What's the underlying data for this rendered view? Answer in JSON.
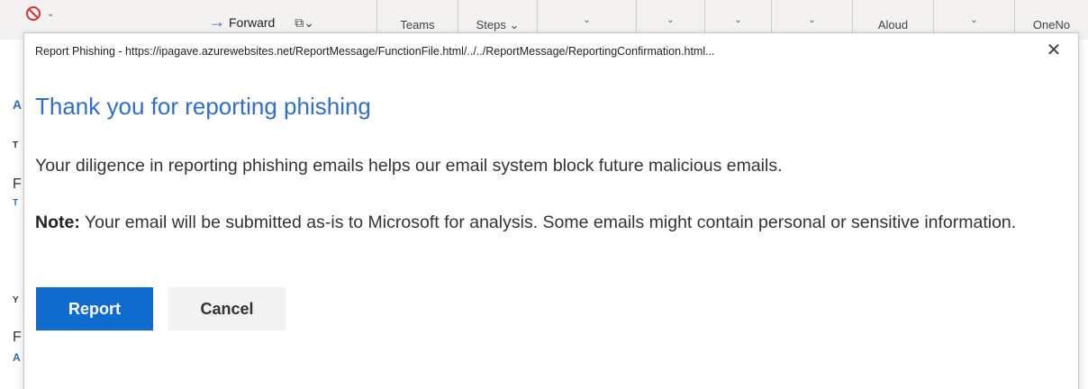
{
  "ribbon": {
    "forward_label": "Forward",
    "share_label": "Teams",
    "quick_steps_label": "Steps",
    "read_aloud_label": "Aloud",
    "onenote_label": "OneNo"
  },
  "leftpane": {
    "letters": [
      "A",
      "T",
      "F",
      "T",
      "Y",
      "F",
      "A"
    ]
  },
  "dialog": {
    "title": "Report Phishing - https://ipagave.azurewebsites.net/ReportMessage/FunctionFile.html/../../ReportMessage/ReportingConfirmation.html...",
    "close_glyph": "✕",
    "heading": "Thank you for reporting phishing",
    "paragraph": "Your diligence in reporting phishing emails helps our email system block future malicious emails.",
    "note_label": "Note:",
    "note_text": " Your email will be submitted as-is to Microsoft for analysis. Some emails might contain personal or sensitive information.",
    "report_button": "Report",
    "cancel_button": "Cancel"
  },
  "colors": {
    "heading": "#2f6ec9",
    "primary_button": "#0f6cce",
    "secondary_button": "#f2f2f2"
  }
}
